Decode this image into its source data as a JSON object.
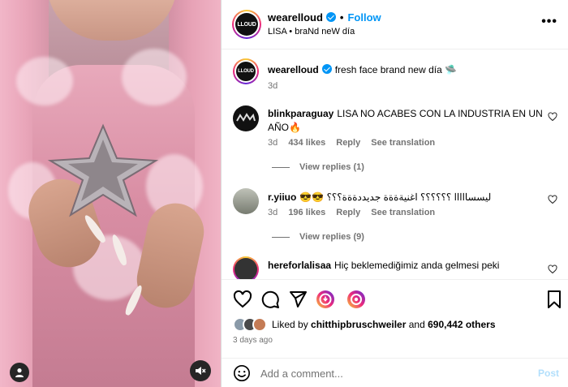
{
  "media": {
    "avatar_icon": "user-icon",
    "mute_icon": "speaker-muted-icon"
  },
  "header": {
    "logo_text": "LLOUD",
    "username": "wearelloud",
    "separator": "•",
    "follow_label": "Follow",
    "subtitle": "LISA • braNd neW día",
    "more_icon": "more-horizontal-icon",
    "more_label": "•••"
  },
  "caption": {
    "username": "wearelloud",
    "text": "fresh face brand new día 🛸",
    "time": "3d"
  },
  "comments": [
    {
      "username": "blinkparaguay",
      "text": "LISA NO ACABES CON LA INDUSTRIA EN UN AÑO🔥",
      "time": "3d",
      "likes": "434 likes",
      "reply": "Reply",
      "translate": "See translation",
      "view_replies": "View replies (1)"
    },
    {
      "username": "r.yiiuo",
      "text": "😎😎 ليسسااااا ؟؟؟؟؟؟ اغنيةةةة جديددةةة؟؟؟",
      "time": "3d",
      "likes": "196 likes",
      "reply": "Reply",
      "translate": "See translation",
      "view_replies": "View replies (9)"
    },
    {
      "username": "hereforlalisaa",
      "text": "Hiç beklemediğimiz anda gelmesi peki"
    }
  ],
  "likes": {
    "prefix": "Liked by",
    "user": "chitthipbruschweiler",
    "and": "and",
    "others": "690,442 others",
    "date": "3 days ago"
  },
  "add_comment": {
    "placeholder": "Add a comment...",
    "post_label": "Post"
  },
  "colors": {
    "accent": "#0095f6",
    "muted": "#737373",
    "post_disabled": "#b2dffc"
  }
}
